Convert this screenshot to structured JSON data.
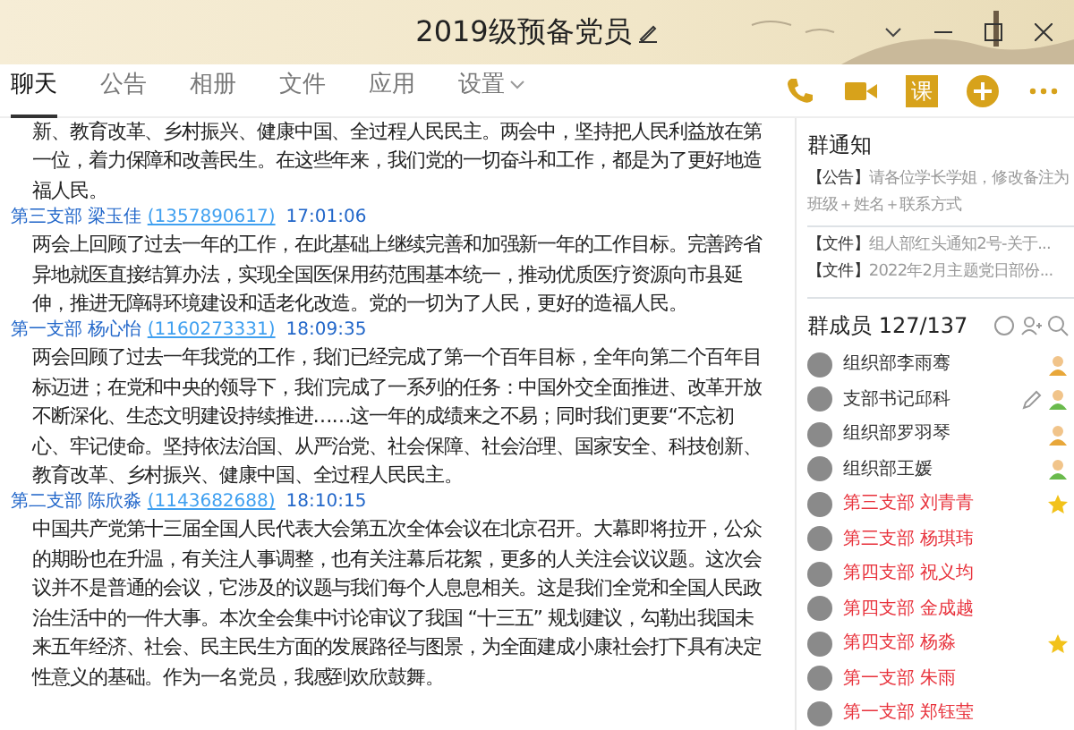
{
  "window": {
    "title": "2019级预备党员"
  },
  "tabs": [
    {
      "label": "聊天",
      "selected": true,
      "dropdown": false
    },
    {
      "label": "公告",
      "selected": false,
      "dropdown": false
    },
    {
      "label": "相册",
      "selected": false,
      "dropdown": false
    },
    {
      "label": "文件",
      "selected": false,
      "dropdown": false
    },
    {
      "label": "应用",
      "selected": false,
      "dropdown": false
    },
    {
      "label": "设置",
      "selected": false,
      "dropdown": true
    }
  ],
  "toolbar": [
    {
      "kind": "phone"
    },
    {
      "kind": "video"
    },
    {
      "kind": "text",
      "label": "课"
    },
    {
      "kind": "plus"
    },
    {
      "kind": "more"
    }
  ],
  "messages": [
    {
      "text": "新、教育改革、乡村振兴、健康中国、全过程人民民主。两会中，坚持把人民利益放在第一位，着力保障和改善民生。在这些年来，我们党的一切奋斗和工作，都是为了更好地造福人民。"
    },
    {
      "sender": "第三支部 梁玉佳",
      "account": "(1357890617)",
      "time": "17:01:06",
      "text": "两会上回顾了过去一年的工作，在此基础上继续完善和加强新一年的工作目标。完善跨省异地就医直接结算办法，实现全国医保用药范围基本统一，推动优质医疗资源向市县延伸，推进无障碍环境建设和适老化改造。党的一切为了人民，更好的造福人民。"
    },
    {
      "sender": "第一支部 杨心怡",
      "account": "(1160273331)",
      "time": "18:09:35",
      "text": "两会回顾了过去一年我党的工作，我们已经完成了第一个百年目标，全年向第二个百年目标迈进；在党和中央的领导下，我们完成了一系列的任务：中国外交全面推进、改革开放不断深化、生态文明建设持续推进……这一年的成绩来之不易；同时我们更要“不忘初心、牢记使命。坚持依法治国、从严治党、社会保障、社会治理、国家安全、科技创新、教育改革、乡村振兴、健康中国、全过程人民民主。"
    },
    {
      "sender": "第二支部 陈欣淼",
      "account": "(1143682688)",
      "time": "18:10:15",
      "text": "中国共产党第十三届全国人民代表大会第五次全体会议在北京召开。大幕即将拉开，公众的期盼也在升温，有关注人事调整，也有关注幕后花絮，更多的人关注会议议题。这次会议并不是普通的会议，它涉及的议题与我们每个人息息相关。这是我们全党和全国人民政治生活中的一件大事。本次全会集中讨论审议了我国 “十三五” 规划建议，勾勒出我国未来五年经济、社会、民主民生方面的发展路径与图景，为全面建成小康社会打下具有决定性意义的基础。作为一名党员，我感到欢欣鼓舞。"
    }
  ],
  "notice_panel": {
    "title": "群通知",
    "items": [
      {
        "tag": "【公告】",
        "text": "请各位学长学姐，修改备注为班级＋姓名＋联系方式"
      },
      {
        "tag": "【文件】",
        "text": "组人部红头通知2号-关于..."
      },
      {
        "tag": "【文件】",
        "text": "2022年2月主题党日部份..."
      }
    ]
  },
  "members_panel": {
    "title": "群成员 127/137",
    "members": [
      {
        "name": "组织部李雨骞",
        "color": "#333333",
        "kind": "owner",
        "editable": false
      },
      {
        "name": "支部书记邱科",
        "color": "#333333",
        "kind": "admin",
        "editable": true
      },
      {
        "name": "组织部罗羽琴",
        "color": "#333333",
        "kind": "owner",
        "editable": false
      },
      {
        "name": "组织部王媛",
        "color": "#333333",
        "kind": "admin",
        "editable": false
      },
      {
        "name": "第三支部 刘青青",
        "color": "#e8323c",
        "kind": "starred",
        "editable": false
      },
      {
        "name": "第三支部 杨琪玮",
        "color": "#e8323c",
        "kind": "plain",
        "editable": false
      },
      {
        "name": "第四支部  祝义均",
        "color": "#e8323c",
        "kind": "plain",
        "editable": false
      },
      {
        "name": "第四支部 金成越",
        "color": "#e8323c",
        "kind": "plain",
        "editable": false
      },
      {
        "name": "第四支部 杨淼",
        "color": "#e8323c",
        "kind": "starred",
        "editable": false
      },
      {
        "name": "第一支部  朱雨",
        "color": "#e8323c",
        "kind": "plain",
        "editable": false
      },
      {
        "name": "第一支部 郑钰莹",
        "color": "#e8323c",
        "kind": "plain",
        "editable": false
      }
    ]
  }
}
